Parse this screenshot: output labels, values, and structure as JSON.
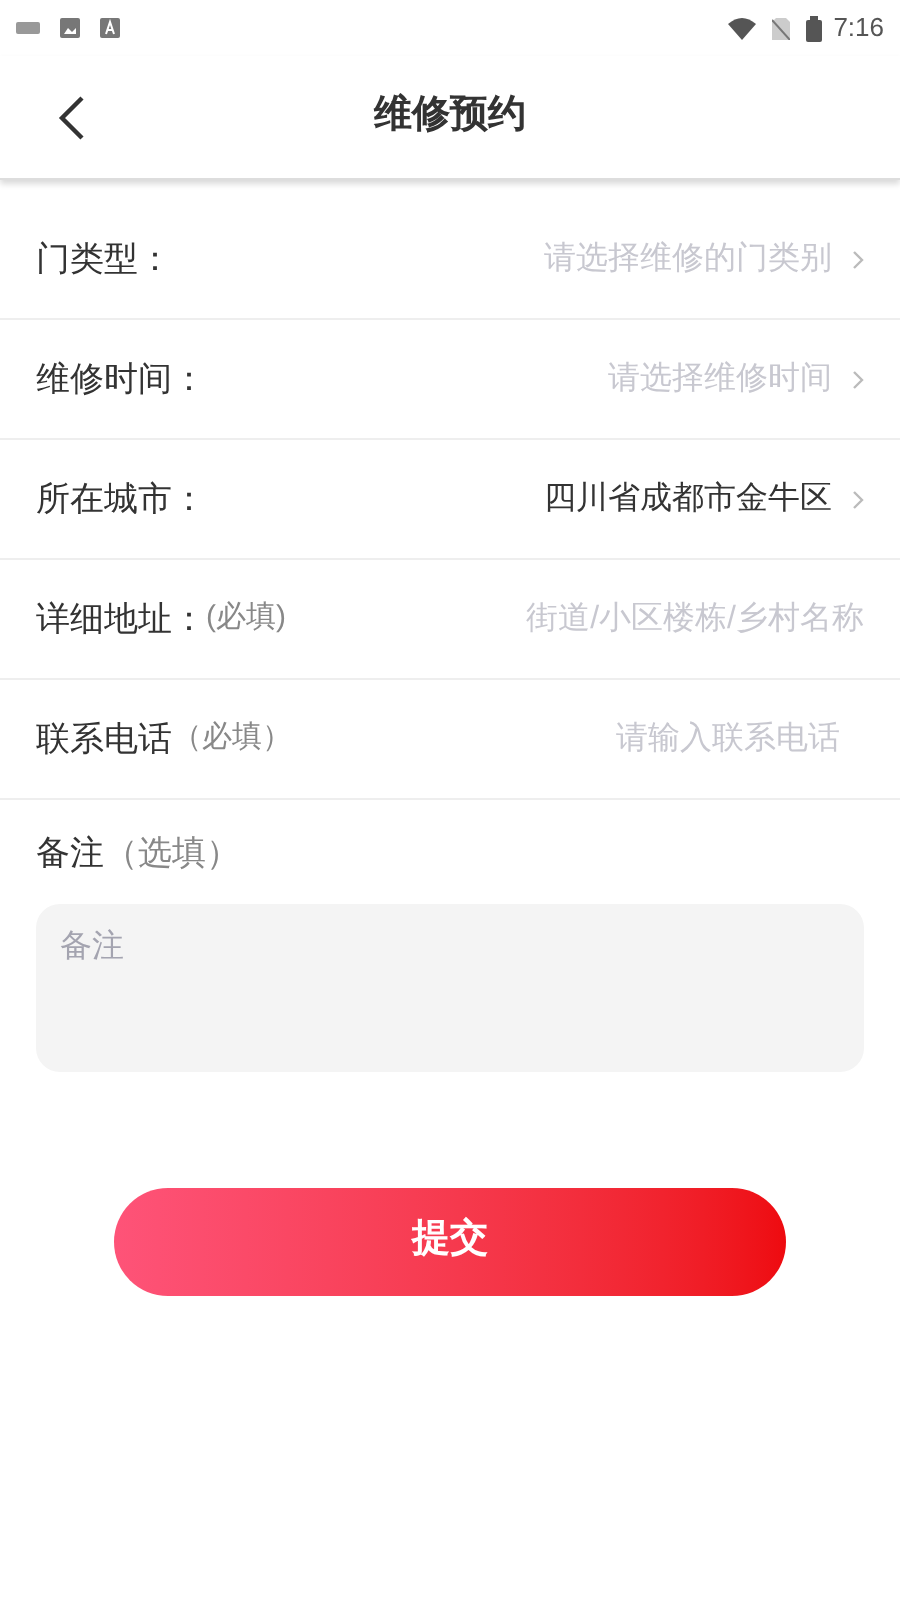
{
  "status_bar": {
    "time": "7:16"
  },
  "header": {
    "title": "维修预约"
  },
  "rows": [
    {
      "kind": "select",
      "label": "门类型：",
      "placeholder": "请选择维修的门类别"
    },
    {
      "kind": "select",
      "label": "维修时间：",
      "placeholder": "请选择维修时间"
    },
    {
      "kind": "select",
      "label": "所在城市：",
      "value": "四川省成都市金牛区"
    },
    {
      "kind": "input",
      "label": "详细地址：",
      "note": "(必填)",
      "placeholder": "街道/小区楼栋/乡村名称"
    },
    {
      "kind": "input",
      "label": "联系电话",
      "note": "（必填）",
      "placeholder": "请输入联系电话"
    }
  ],
  "remarks": {
    "label": "备注",
    "note": "（选填）",
    "placeholder": "备注"
  },
  "submit": {
    "label": "提交"
  }
}
